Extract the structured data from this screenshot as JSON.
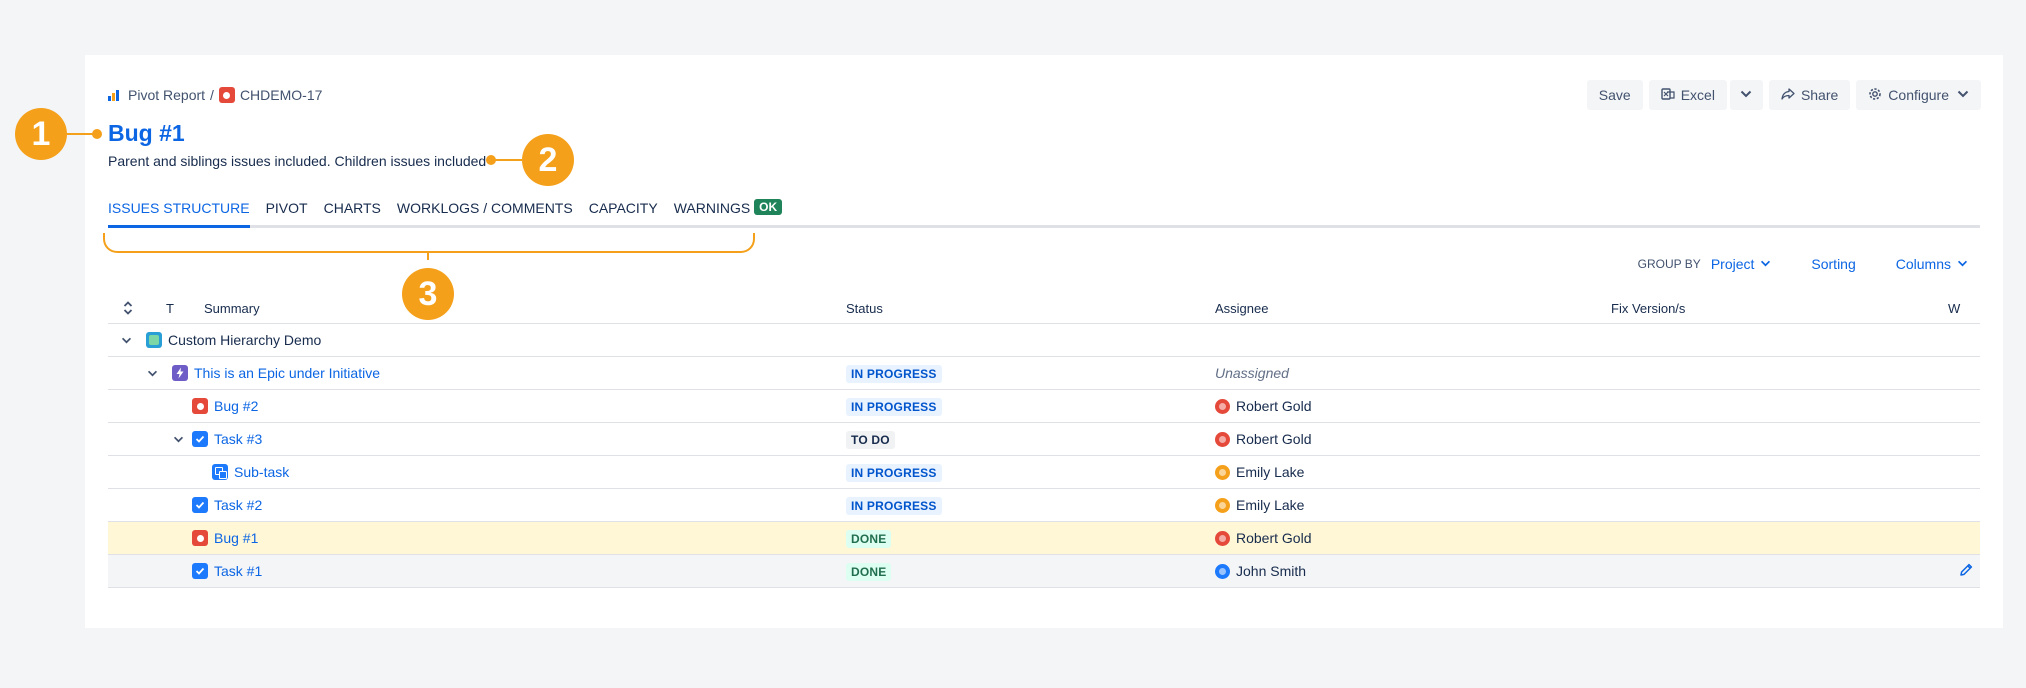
{
  "breadcrumb": {
    "root": "Pivot Report",
    "separator": "/",
    "issue_key": "CHDEMO-17"
  },
  "toolbar": {
    "save": "Save",
    "excel": "Excel",
    "share": "Share",
    "configure": "Configure"
  },
  "issue": {
    "title": "Bug #1",
    "subtitle": "Parent and siblings issues included. Children issues included"
  },
  "callouts": [
    "1",
    "2",
    "3"
  ],
  "tabs": [
    {
      "label": "ISSUES STRUCTURE"
    },
    {
      "label": "PIVOT"
    },
    {
      "label": "CHARTS"
    },
    {
      "label": "WORKLOGS / COMMENTS"
    },
    {
      "label": "CAPACITY"
    },
    {
      "label": "WARNINGS",
      "badge": "OK"
    }
  ],
  "grid_controls": {
    "group_by_label": "GROUP BY",
    "group_by_value": "Project",
    "sorting": "Sorting",
    "columns": "Columns"
  },
  "table": {
    "headers": {
      "type": "T",
      "summary": "Summary",
      "status": "Status",
      "assignee": "Assignee",
      "fix_version": "Fix Version/s",
      "w": "W"
    },
    "rows": [
      {
        "summary": "Custom Hierarchy Demo",
        "status": "",
        "assignee": ""
      },
      {
        "summary": "This is an Epic under Initiative",
        "status": "IN PROGRESS",
        "assignee": "Unassigned"
      },
      {
        "summary": "Bug #2",
        "status": "IN PROGRESS",
        "assignee": "Robert Gold"
      },
      {
        "summary": "Task #3",
        "status": "TO DO",
        "assignee": "Robert Gold"
      },
      {
        "summary": "Sub-task",
        "status": "IN PROGRESS",
        "assignee": "Emily Lake"
      },
      {
        "summary": "Task #2",
        "status": "IN PROGRESS",
        "assignee": "Emily Lake"
      },
      {
        "summary": "Bug #1",
        "status": "DONE",
        "assignee": "Robert Gold"
      },
      {
        "summary": "Task #1",
        "status": "DONE",
        "assignee": "John Smith"
      }
    ]
  },
  "colors": {
    "accent": "#0c66e4",
    "callout": "#f5a01a",
    "highlight_row": "#fff7d6",
    "ok_badge": "#1f845a"
  }
}
